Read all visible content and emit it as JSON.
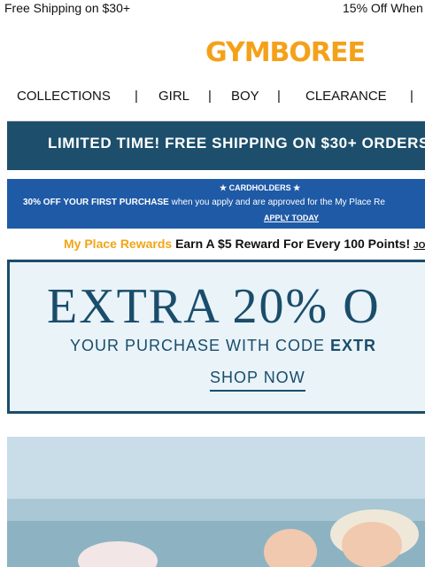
{
  "topbar": {
    "left_text": "Free Shipping on $30+",
    "right_text": "15% Off When"
  },
  "logo": {
    "text": "GYMBOREE"
  },
  "nav": {
    "items": [
      "COLLECTIONS",
      "GIRL",
      "BOY",
      "CLEARANCE"
    ],
    "separator": "|"
  },
  "shipping_banner": {
    "text": "LIMITED TIME! FREE SHIPPING ON $30+ ORDERS"
  },
  "card_banner": {
    "line1": "CARDHOLDERS",
    "line2_bold": "30% OFF YOUR FIRST PURCHASE",
    "line2_rest": "when you apply and are approved for the My Place Re",
    "cta": "APPLY TODAY"
  },
  "rewards": {
    "brand": "My Place Rewards",
    "message": "Earn A $5 Reward For Every 100 Points!",
    "link": "JO"
  },
  "promo": {
    "headline": "EXTRA 20% O",
    "subline": "YOUR PURCHASE WITH CODE",
    "code": "EXTR",
    "cta": "SHOP NOW"
  },
  "colors": {
    "brand_orange": "#f4a11a",
    "navy": "#1a4d6b",
    "card_blue": "#1f5aa6",
    "rewards_orange": "#f2a516"
  }
}
